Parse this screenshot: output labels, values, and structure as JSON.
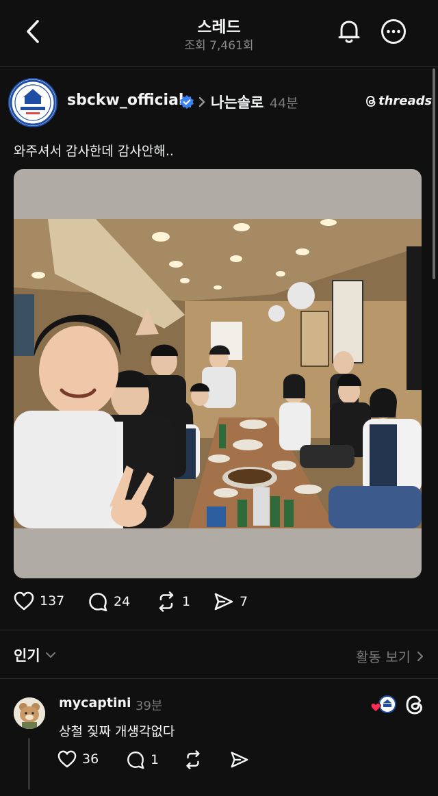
{
  "header": {
    "title": "스레드",
    "views": "조회 7,461회"
  },
  "post": {
    "username": "sbckw_official",
    "topic": "나는솔로",
    "time": "44분",
    "threads_label": "threads",
    "text": "와주셔서 감사한데 감사안해..",
    "likes": "137",
    "replies": "24",
    "reposts": "1",
    "shares": "7"
  },
  "sort": {
    "label": "인기",
    "activity_label": "활동 보기"
  },
  "comment": {
    "username": "mycaptini",
    "time": "39분",
    "text": "상철 짖짜 개생각없다",
    "likes": "36",
    "replies": "1"
  },
  "colors": {
    "background": "#101010",
    "text": "#f3f5f7",
    "muted": "#7a7a7a",
    "verified": "#3b82f6",
    "heart": "#ff2d55"
  }
}
